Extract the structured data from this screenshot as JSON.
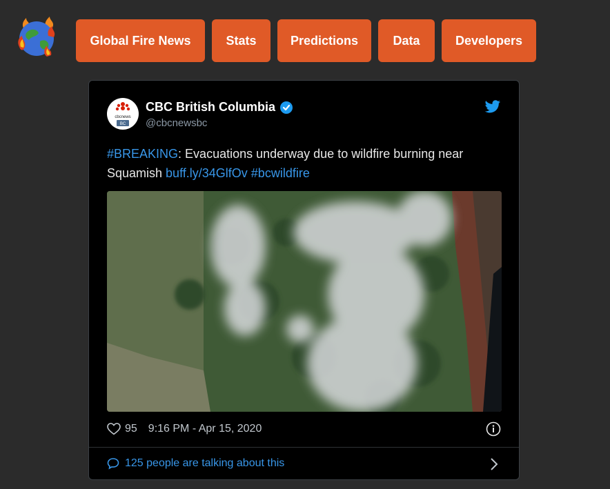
{
  "nav": {
    "items": [
      {
        "label": "Global Fire News"
      },
      {
        "label": "Stats"
      },
      {
        "label": "Predictions"
      },
      {
        "label": "Data"
      },
      {
        "label": "Developers"
      }
    ]
  },
  "tweet": {
    "author_name": "CBC British Columbia",
    "handle": "@cbcnewsbc",
    "text_hashtag": "#BREAKING",
    "text_body": ": Evacuations underway due to wildfire burning near Squamish ",
    "text_link": "buff.ly/34GlfOv",
    "text_hashtag2": "#bcwildfire",
    "likes": "95",
    "timestamp": "9:16 PM - Apr 15, 2020",
    "talking": "125 people are talking about this"
  },
  "avatar": {
    "brand": "cbcnews",
    "region": "BC"
  },
  "colors": {
    "accent": "#e05a27",
    "link": "#3896e8",
    "background": "#2b2b2b",
    "card": "#000000"
  },
  "icons": {
    "logo": "burning-globe-icon",
    "verified": "verified-badge-icon",
    "twitter": "twitter-bird-icon",
    "like": "heart-icon",
    "info": "info-icon",
    "comment": "speech-bubble-icon",
    "chevron": "chevron-right-icon"
  }
}
